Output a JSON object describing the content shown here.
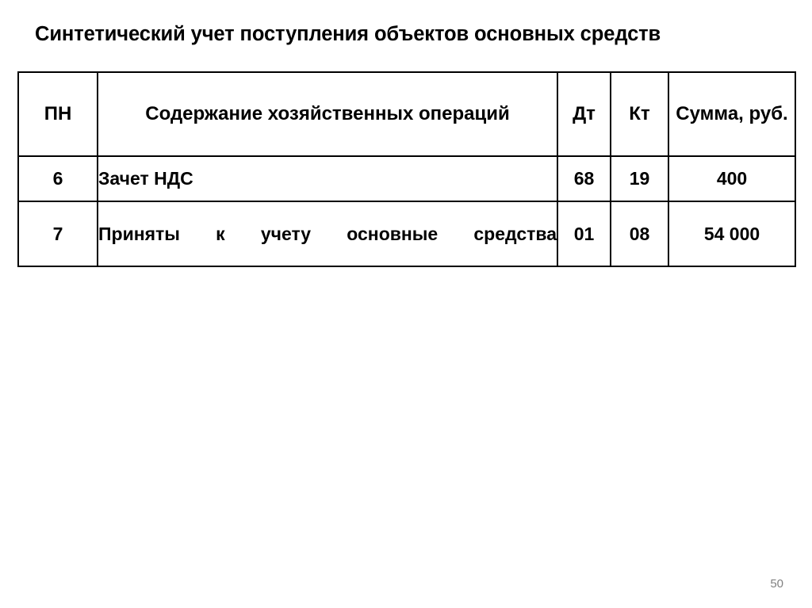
{
  "slide": {
    "title": "Синтетический учет поступления объектов основных средств",
    "page_number": "50"
  },
  "table": {
    "headers": {
      "num": "ПН",
      "description": "Содержание хозяйственных операций",
      "debit": "Дт",
      "credit": "Кт",
      "amount": "Сумма, руб."
    },
    "rows": [
      {
        "num": "6",
        "description": "Зачет НДС",
        "debit": "68",
        "credit": "19",
        "amount": "400"
      },
      {
        "num": "7",
        "description": "Приняты к учету основные средства",
        "debit": "01",
        "credit": "08",
        "amount": "54 000"
      }
    ]
  }
}
